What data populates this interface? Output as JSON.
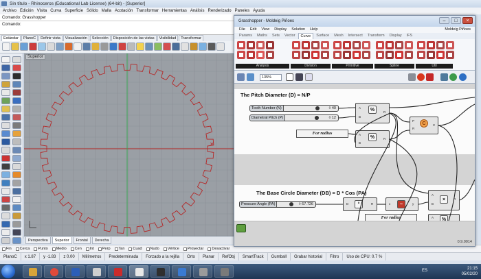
{
  "rhino": {
    "title": "Sin título - Rhinoceros (Educational Lab License) (64-bit) - [Superior]",
    "menu": [
      "Archivo",
      "Edición",
      "Visita",
      "Curva",
      "Superficie",
      "Sólido",
      "Malla",
      "Acotación",
      "Transformar",
      "Herramientas",
      "Análisis",
      "Renderizado",
      "Paneles",
      "Ayuda"
    ],
    "command_history": "Comando: Grasshopper",
    "command_prompt": "Comando:",
    "toolbar_tabs": [
      "Estándar",
      "PlanoC",
      "Definir vista",
      "Visualización",
      "Selección",
      "Disposición de las vistas",
      "Visibilidad",
      "Transformar"
    ],
    "viewport_label": "Superior",
    "viewport_tabs": [
      "Perspectiva",
      "Superior",
      "Frontal",
      "Derecha"
    ],
    "osnaps": [
      "Fin",
      "Cerca",
      "Punto",
      "Medio",
      "Cen",
      "Int",
      "Perp",
      "Tan",
      "Cuad",
      "Nudo",
      "Vértice",
      "Proyectar",
      "Desactivar"
    ],
    "status": {
      "plane": "PlanoC",
      "x": "x 1.87",
      "y": "y -1.83",
      "z": "z 0.00",
      "units": "Milímetros",
      "layer": "Predeterminada",
      "grid_snap": "Forzado a la rejilla",
      "ortho": "Orto",
      "planar": "Planar",
      "refobj": "RefObj",
      "smarttrack": "SmartTrack",
      "gumball": "Gumball",
      "history": "Grabar historial",
      "filter": "Filtro",
      "cpu": "Uso de CPU: 0.7 %"
    }
  },
  "gh": {
    "title": "Grasshopper - Moldeig Piñoes",
    "menu": [
      "File",
      "Edit",
      "View",
      "Display",
      "Solution",
      "Help"
    ],
    "menu_right": "Moldeig Piñoes",
    "tabs": [
      "Params",
      "Maths",
      "Sets",
      "Vector",
      "Curve",
      "Surface",
      "Mesh",
      "Intersect",
      "Transform",
      "Display",
      "IFS"
    ],
    "active_tab": "Curve",
    "ribbon_groups": [
      "Analysis",
      "Division",
      "Primitive",
      "Spline",
      "Util"
    ],
    "zoom": "135%",
    "version": "0.9.0014",
    "group1": {
      "title": "The Pitch Diameter (D) = N/P",
      "slider1": {
        "label": "Tooth Number (N)",
        "value": "◊ 40"
      },
      "slider2": {
        "label": "Diametral Pitch (P)",
        "value": "◊ 12"
      },
      "panel": "For radius"
    },
    "group2": {
      "title": "The Base Circle Diameter (DB) = D * Cos (PA)",
      "slider1": {
        "label": "Pressure Angle (PA)",
        "value": "◊ 67.726"
      },
      "panel": "For radius"
    }
  },
  "taskbar": {
    "lang": "ES",
    "time": "21:15",
    "date": "05/02/20"
  },
  "colors": {
    "gear_curve": "#b52828",
    "grid_x": "#b52828",
    "grid_y": "#2fa84a",
    "gh_group_bg": "#fbfbfb",
    "gh_canvas": "#d4d4d4"
  }
}
